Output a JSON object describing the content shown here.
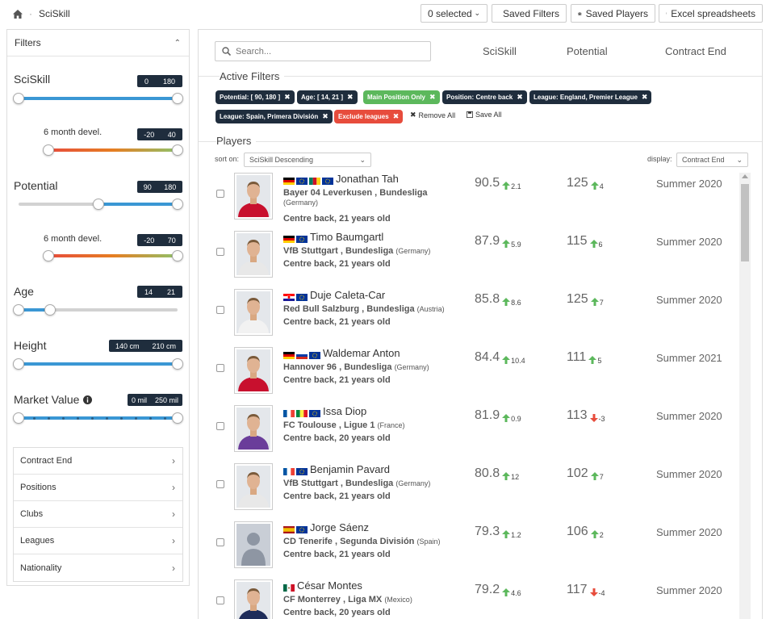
{
  "breadcrumb": {
    "title": "SciSkill"
  },
  "toolbar": {
    "selected_label": "0 selected",
    "saved_filters": "Saved Filters",
    "saved_players": "Saved Players",
    "excel": "Excel spreadsheets"
  },
  "filters": {
    "title": "Filters",
    "sciskill": {
      "label": "SciSkill",
      "min": "0",
      "max": "180",
      "low_frac": 0.0,
      "high_frac": 1.0
    },
    "sciskill_devel": {
      "label": "6 month devel.",
      "min": "-20",
      "max": "40",
      "low_frac": 0.0,
      "high_frac": 1.0
    },
    "potential": {
      "label": "Potential",
      "min": "90",
      "max": "180",
      "low_frac": 0.5,
      "high_frac": 1.0
    },
    "potential_devel": {
      "label": "6 month devel.",
      "min": "-20",
      "max": "70",
      "low_frac": 0.0,
      "high_frac": 1.0
    },
    "age": {
      "label": "Age",
      "min": "14",
      "max": "21",
      "low_frac": 0.0,
      "high_frac": 0.2
    },
    "height": {
      "label": "Height",
      "min": "140 cm",
      "max": "210 cm",
      "low_frac": 0.0,
      "high_frac": 1.0
    },
    "market_value": {
      "label": "Market Value",
      "min": "0 mil",
      "max": "250 mil",
      "low_frac": 0.0,
      "high_frac": 1.0
    },
    "accordion": [
      "Contract End",
      "Positions",
      "Clubs",
      "Leagues",
      "Nationality"
    ]
  },
  "main": {
    "search_placeholder": "Search...",
    "columns": {
      "sciskill": "SciSkill",
      "potential": "Potential",
      "contract": "Contract End"
    },
    "active_filters_title": "Active Filters",
    "chips": [
      {
        "label": "Potential: [ 90, 180 ]",
        "style": "dark"
      },
      {
        "label": "Age: [ 14, 21 ]",
        "style": "dark"
      },
      {
        "label": "Main Position Only",
        "style": "green"
      },
      {
        "label": "Position: Centre back",
        "style": "dark"
      },
      {
        "label": "League: England, Premier League",
        "style": "dark"
      },
      {
        "label": "League: Spain, Primera División",
        "style": "dark"
      },
      {
        "label": "Exclude leagues",
        "style": "red"
      }
    ],
    "remove_all": "Remove All",
    "save_all": "Save All",
    "players_title": "Players",
    "sort_label": "sort on:",
    "sort_value": "SciSkill Descending",
    "display_label": "display:",
    "display_value": "Contract End"
  },
  "players": [
    {
      "name": "Jonathan Tah",
      "flags": [
        "de",
        "eu",
        "cm",
        "eu"
      ],
      "club": "Bayer 04 Leverkusen",
      "league": "Bundesliga",
      "country": "(Germany)",
      "country_newline": true,
      "position": "Centre back, 21 years old",
      "sciskill": "90.5",
      "sciskill_delta": "2.1",
      "sciskill_dir": "up",
      "potential": "125",
      "potential_delta": "4",
      "potential_dir": "up",
      "contract": "Summer 2020",
      "kit": "#c8102e"
    },
    {
      "name": "Timo Baumgartl",
      "flags": [
        "de",
        "eu"
      ],
      "club": "VfB Stuttgart",
      "league": "Bundesliga",
      "country": "(Germany)",
      "country_newline": false,
      "position": "Centre back, 21 years old",
      "sciskill": "87.9",
      "sciskill_delta": "5.9",
      "sciskill_dir": "up",
      "potential": "115",
      "potential_delta": "6",
      "potential_dir": "up",
      "contract": "Summer 2020",
      "kit": "#e8e8e8"
    },
    {
      "name": "Duje Caleta-Car",
      "flags": [
        "hr",
        "eu"
      ],
      "club": "Red Bull Salzburg",
      "league": "Bundesliga",
      "country": "(Austria)",
      "country_newline": false,
      "position": "Centre back, 21 years old",
      "sciskill": "85.8",
      "sciskill_delta": "8.6",
      "sciskill_dir": "up",
      "potential": "125",
      "potential_delta": "7",
      "potential_dir": "up",
      "contract": "Summer 2020",
      "kit": "#f2f2f2"
    },
    {
      "name": "Waldemar Anton",
      "flags": [
        "de",
        "ru",
        "eu"
      ],
      "club": "Hannover 96",
      "league": "Bundesliga",
      "country": "(Germany)",
      "country_newline": false,
      "position": "Centre back, 21 years old",
      "sciskill": "84.4",
      "sciskill_delta": "10.4",
      "sciskill_dir": "up",
      "potential": "111",
      "potential_delta": "5",
      "potential_dir": "up",
      "contract": "Summer 2021",
      "kit": "#c8102e"
    },
    {
      "name": "Issa Diop",
      "flags": [
        "fr",
        "sn",
        "eu"
      ],
      "club": "FC Toulouse",
      "league": "Ligue 1",
      "country": "(France)",
      "country_newline": false,
      "position": "Centre back, 20 years old",
      "sciskill": "81.9",
      "sciskill_delta": "0.9",
      "sciskill_dir": "up",
      "potential": "113",
      "potential_delta": "-3",
      "potential_dir": "down",
      "contract": "Summer 2020",
      "kit": "#6a3d9a"
    },
    {
      "name": "Benjamin Pavard",
      "flags": [
        "fr",
        "eu"
      ],
      "club": "VfB Stuttgart",
      "league": "Bundesliga",
      "country": "(Germany)",
      "country_newline": false,
      "position": "Centre back, 21 years old",
      "sciskill": "80.8",
      "sciskill_delta": "12",
      "sciskill_dir": "up",
      "potential": "102",
      "potential_delta": "7",
      "potential_dir": "up",
      "contract": "Summer 2020",
      "kit": "#e8e8e8"
    },
    {
      "name": "Jorge Sáenz",
      "flags": [
        "es",
        "eu"
      ],
      "club": "CD Tenerife",
      "league": "Segunda División",
      "country": "(Spain)",
      "country_newline": false,
      "position": "Centre back, 21 years old",
      "sciskill": "79.3",
      "sciskill_delta": "1.2",
      "sciskill_dir": "up",
      "potential": "106",
      "potential_delta": "2",
      "potential_dir": "up",
      "contract": "Summer 2020",
      "kit": "placeholder"
    },
    {
      "name": "César Montes",
      "flags": [
        "mx"
      ],
      "club": "CF Monterrey",
      "league": "Liga MX",
      "country": "(Mexico)",
      "country_newline": false,
      "position": "Centre back, 20 years old",
      "sciskill": "79.2",
      "sciskill_delta": "4.6",
      "sciskill_dir": "up",
      "potential": "117",
      "potential_delta": "-4",
      "potential_dir": "down",
      "contract": "Summer 2020",
      "kit": "#1f2d5a"
    }
  ]
}
